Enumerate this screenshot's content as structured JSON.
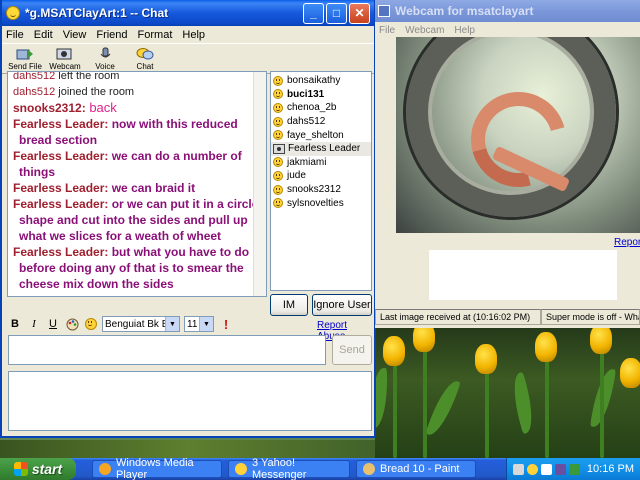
{
  "chat": {
    "title": "*g.MSATClayArt:1 -- Chat",
    "menu": [
      "File",
      "Edit",
      "View",
      "Friend",
      "Format",
      "Help"
    ],
    "toolbar": [
      "Send File",
      "Webcam",
      "Voice",
      "Chat"
    ],
    "messages": [
      {
        "kind": "sys",
        "nick": "dahs512",
        "text": " left the room"
      },
      {
        "kind": "sys",
        "nick": "dahs512",
        "text": " joined the room"
      },
      {
        "kind": "snooks",
        "nick": "snooks2312:",
        "text": " back"
      },
      {
        "kind": "user",
        "nick": "Fearless Leader:",
        "text": " now with this reduced bread section"
      },
      {
        "kind": "user",
        "nick": "Fearless Leader:",
        "text": " we can do a number of things"
      },
      {
        "kind": "user",
        "nick": "Fearless Leader:",
        "text": " we can braid it"
      },
      {
        "kind": "user",
        "nick": "Fearless Leader:",
        "text": " or we can put it in a circle shape and cut into the sides and pull up what we slices for a weath of wheet"
      },
      {
        "kind": "user",
        "nick": "Fearless Leader:",
        "text": " but what you have to do before doing any of that is to smear the cheese mix down the sides"
      }
    ],
    "users": [
      {
        "name": "bonsaikathy",
        "icon": "smile"
      },
      {
        "name": "buci131",
        "icon": "smile",
        "bold": true
      },
      {
        "name": "chenoa_2b",
        "icon": "smile"
      },
      {
        "name": "dahs512",
        "icon": "smile"
      },
      {
        "name": "faye_shelton",
        "icon": "smile"
      },
      {
        "name": "Fearless Leader",
        "icon": "webcam",
        "selected": true
      },
      {
        "name": "jakmiami",
        "icon": "smile"
      },
      {
        "name": "jude",
        "icon": "smile"
      },
      {
        "name": "snooks2312",
        "icon": "smile"
      },
      {
        "name": "sylsnovelties",
        "icon": "smile"
      }
    ],
    "im_label": "IM",
    "ignore_label": "Ignore User",
    "format": {
      "bold": "B",
      "italic": "I",
      "underline": "U",
      "font": "Benguiat Bk BT",
      "size": "11"
    },
    "report_abuse": "Report Abuse",
    "send_label": "Send"
  },
  "webcam": {
    "title": "Webcam for msatclayart",
    "menu": [
      "File",
      "Webcam",
      "Help"
    ],
    "report_link": "Report",
    "status_received": "Last image received at (10:16:02 PM)",
    "status_super": "Super mode is off - What"
  },
  "taskbar": {
    "start_label": "start",
    "tasks": [
      {
        "label": "Windows Media Player",
        "color": "#f5a623"
      },
      {
        "label": "3 Yahoo! Messenger",
        "color": "#ffd23a"
      },
      {
        "label": "Bread 10 - Paint",
        "color": "#e8c070"
      }
    ],
    "clock": "10:16 PM"
  },
  "colors": {
    "titlebar": "#1659dc",
    "nick": "#a02030",
    "message": "#8a1078",
    "link": "#0000cc"
  }
}
